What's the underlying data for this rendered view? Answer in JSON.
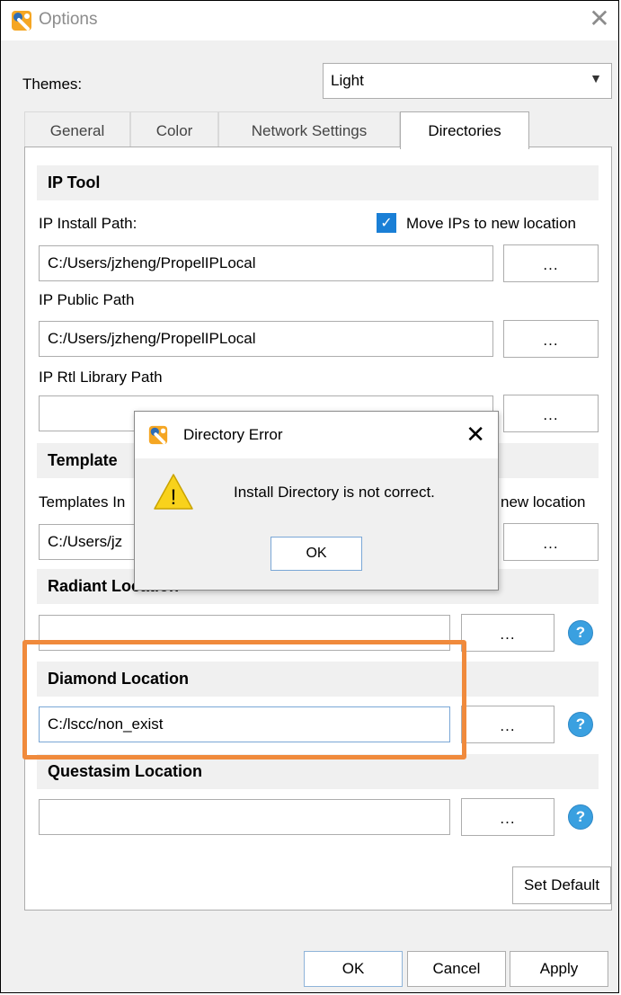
{
  "window": {
    "title": "Options"
  },
  "themes": {
    "label": "Themes:",
    "value": "Light"
  },
  "tabs": [
    "General",
    "Color",
    "Network Settings",
    "Directories"
  ],
  "ip_tool": {
    "header": "IP Tool",
    "install_label": "IP Install Path:",
    "move_checkbox_label": "Move IPs to new location",
    "move_checked": true,
    "install_value": "C:/Users/jzheng/PropelIPLocal",
    "public_label": "IP Public Path",
    "public_value": "C:/Users/jzheng/PropelIPLocal",
    "rtl_label": "IP Rtl Library Path",
    "rtl_value": ""
  },
  "templates": {
    "header": "Template",
    "install_label": "Templates In",
    "move_label_fragment": "new location",
    "install_value": "C:/Users/jz"
  },
  "radiant": {
    "header": "Radiant Location",
    "value": ""
  },
  "diamond": {
    "header": "Diamond Location",
    "value": "C:/lscc/non_exist"
  },
  "questasim": {
    "header": "Questasim Location",
    "value": ""
  },
  "browse_label": "...",
  "help_label": "?",
  "set_default_label": "Set Default",
  "footer": {
    "ok": "OK",
    "cancel": "Cancel",
    "apply": "Apply"
  },
  "dialog": {
    "title": "Directory Error",
    "message": "Install Directory is not correct.",
    "ok": "OK",
    "warning_glyph": "!"
  },
  "colors": {
    "highlight": "#f08a3c",
    "accent": "#1a7fd6",
    "help": "#3aa0e0"
  }
}
